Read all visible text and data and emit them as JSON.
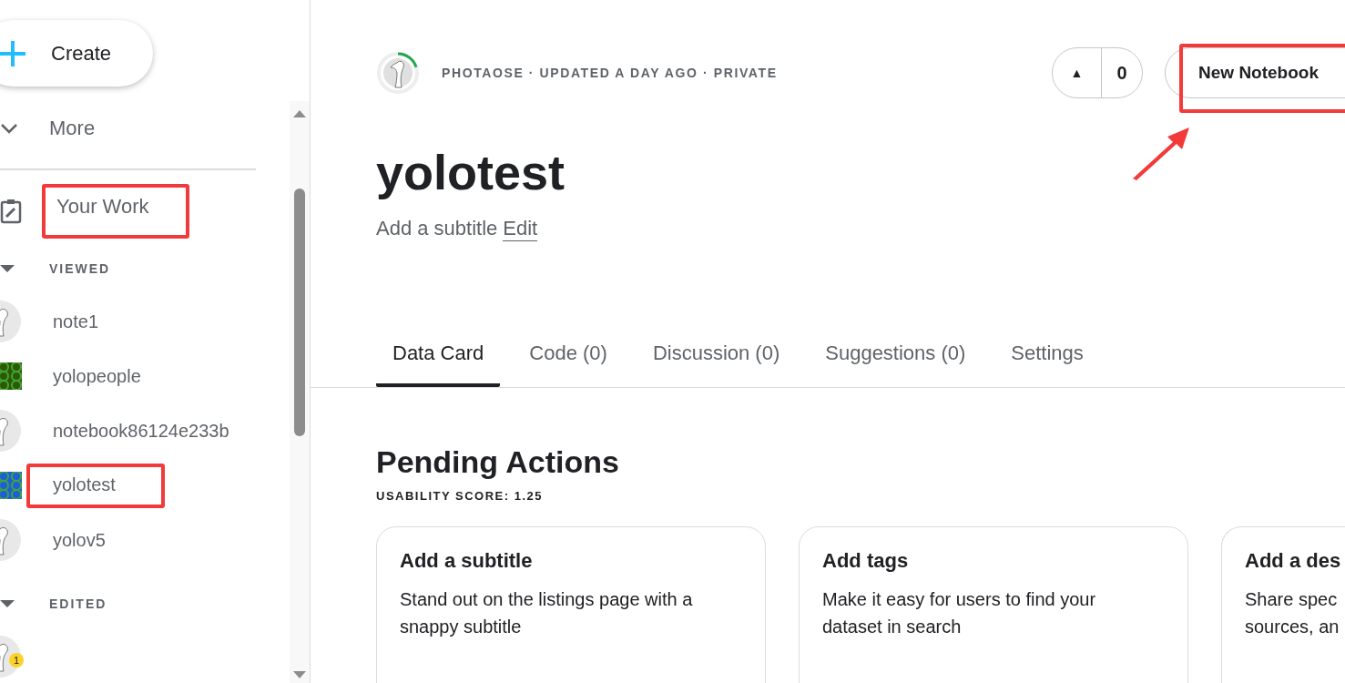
{
  "sidebar": {
    "create": {
      "label": "Create"
    },
    "more": {
      "label": "More",
      "expanded": false
    },
    "your_work": {
      "label": "Your Work",
      "highlighted": true
    },
    "sections": [
      {
        "title": "VIEWED",
        "expanded": true,
        "items": [
          {
            "label": "note1",
            "kind": "avatar",
            "highlighted": false
          },
          {
            "label": "yolopeople",
            "kind": "dataset",
            "color": "#2d5a00",
            "highlighted": false
          },
          {
            "label": "notebook86124e233b",
            "kind": "avatar",
            "highlighted": false
          },
          {
            "label": "yolotest",
            "kind": "dataset",
            "color": "#1f5fd6",
            "highlighted": true
          },
          {
            "label": "yolov5",
            "kind": "avatar",
            "highlighted": false
          }
        ]
      },
      {
        "title": "EDITED",
        "expanded": true,
        "items": [
          {
            "kind": "avatar",
            "badge": "1"
          }
        ]
      }
    ]
  },
  "header": {
    "meta": "PHOTAOSE · UPDATED A DAY AGO · PRIVATE",
    "progress": {
      "level": 0.2
    },
    "votes": "0",
    "upvote": "▲",
    "new_notebook": {
      "label": "New Notebook",
      "highlighted": true,
      "arrow": true
    }
  },
  "title": "yolotest",
  "subtitle": {
    "text": "Add a subtitle",
    "link": "Edit"
  },
  "tabs": [
    {
      "label": "Data Card",
      "selected": true
    },
    {
      "label": "Code (0)",
      "selected": false
    },
    {
      "label": "Discussion (0)",
      "selected": false
    },
    {
      "label": "Suggestions (0)",
      "selected": false
    },
    {
      "label": "Settings",
      "selected": false
    }
  ],
  "pending": {
    "title": "Pending Actions",
    "score": "USABILITY SCORE: 1.25",
    "cards": [
      {
        "title": "Add a subtitle",
        "text": "Stand out on the listings page with a snappy subtitle"
      },
      {
        "title": "Add tags",
        "text": "Make it easy for users to find your dataset in search"
      },
      {
        "title": "Add a des",
        "text": "Share spec sources, an"
      }
    ]
  }
}
